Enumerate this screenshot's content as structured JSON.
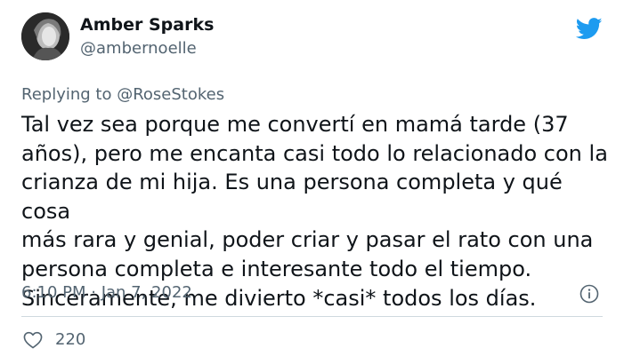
{
  "tweet": {
    "author": {
      "display_name": "Amber Sparks",
      "handle": "@ambernoelle",
      "avatar": "avatar-photo"
    },
    "brand_icon": "twitter-bird-icon",
    "brand_color": "#1d9bf0",
    "replying_prefix": "Replying to",
    "replying_to": "@RoseStokes",
    "text": "Tal vez sea porque me convertí en mamá tarde (37\naños), pero me encanta casi todo lo relacionado con la\ncrianza de mi hija. Es una persona completa y qué cosa\nmás rara y genial, poder criar y pasar el rato con una\npersona completa e interesante todo el tiempo.\nSinceramente, me divierto *casi* todos los días.",
    "timestamp": "6:10 PM · Jan 7, 2022",
    "info_icon": "info-icon",
    "likes": {
      "icon": "heart-icon",
      "count": "220"
    },
    "text_color": "#0f1419",
    "secondary_color": "#536471"
  }
}
